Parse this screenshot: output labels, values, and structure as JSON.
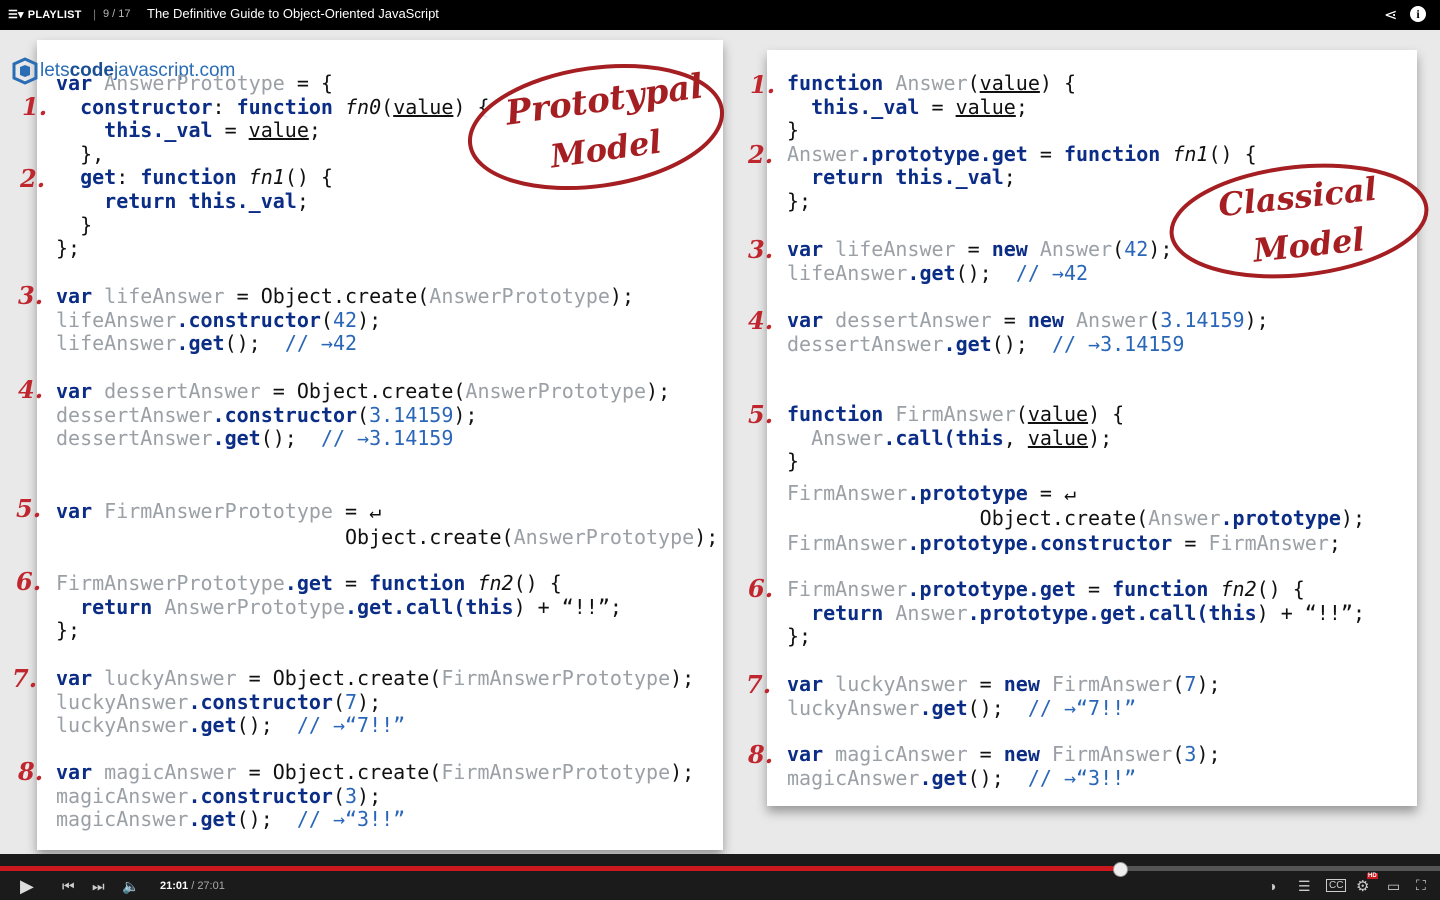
{
  "topbar": {
    "playlist_label": "PLAYLIST",
    "position": "9 / 17",
    "title": "The Definitive Guide to Object-Oriented JavaScript"
  },
  "logo": {
    "prefix": "lets",
    "bold": "code",
    "suffix": "javascript.com"
  },
  "stamps": {
    "prototypal": {
      "line1": "Prototypal",
      "line2": "Model"
    },
    "classical": {
      "line1": "Classical",
      "line2": "Model"
    }
  },
  "numbers": {
    "n1": "1.",
    "n2": "2.",
    "n3": "3.",
    "n4": "4.",
    "n5": "5.",
    "n6": "6.",
    "n7": "7.",
    "n8": "8."
  },
  "left_code": {
    "l1": "var ",
    "l1b": "AnswerPrototype",
    "l1c": " = {",
    "l2a": "  constructor",
    "l2b": ": ",
    "l2c": "function",
    "l2d": " fn0",
    "l2e": "(",
    "l2f": "value",
    "l2g": ") {",
    "l3a": "    this",
    "l3b": "._val",
    "l3c": " = ",
    "l3d": "value",
    "l3e": ";",
    "l4": "  },",
    "l5a": "  get",
    "l5b": ": ",
    "l5c": "function",
    "l5d": " fn1",
    "l5e": "() {",
    "l6a": "    return this",
    "l6b": "._val",
    "l6c": ";",
    "l7": "  }",
    "l8": "};",
    "b3a": "var ",
    "b3b": "lifeAnswer",
    "b3c": " = Object.create(",
    "b3d": "AnswerPrototype",
    "b3e": ");",
    "b3f": "lifeAnswer",
    "b3g": ".constructor",
    "b3h": "(",
    "b3i": "42",
    "b3j": ");",
    "b3k": "lifeAnswer",
    "b3l": ".get",
    "b3m": "();  ",
    "b3n": "// →42",
    "b4a": "var ",
    "b4b": "dessertAnswer",
    "b4c": " = Object.create(",
    "b4d": "AnswerPrototype",
    "b4e": ");",
    "b4f": "dessertAnswer",
    "b4g": ".constructor",
    "b4h": "(",
    "b4i": "3.14159",
    "b4j": ");",
    "b4k": "dessertAnswer",
    "b4l": ".get",
    "b4m": "();  ",
    "b4n": "// →3.14159",
    "b5a": "var ",
    "b5b": "FirmAnswerPrototype",
    "b5c": " = ↵",
    "b5d": "                        Object.create(",
    "b5e": "AnswerPrototype",
    "b5f": ");",
    "b6a": "FirmAnswerPrototype",
    "b6b": ".get",
    "b6c": " = ",
    "b6d": "function",
    "b6e": " fn2",
    "b6f": "() {",
    "b6g": "  return ",
    "b6h": "AnswerPrototype",
    "b6i": ".get.call(",
    "b6j": "this",
    "b6k": ") + “!!”;",
    "b6l": "};",
    "b7a": "var ",
    "b7b": "luckyAnswer",
    "b7c": " = Object.create(",
    "b7d": "FirmAnswerPrototype",
    "b7e": ");",
    "b7f": "luckyAnswer",
    "b7g": ".constructor",
    "b7h": "(",
    "b7i": "7",
    "b7j": ");",
    "b7k": "luckyAnswer",
    "b7l": ".get",
    "b7m": "();  ",
    "b7n": "// →“7!!”",
    "b8a": "var ",
    "b8b": "magicAnswer",
    "b8c": " = Object.create(",
    "b8d": "FirmAnswerPrototype",
    "b8e": ");",
    "b8f": "magicAnswer",
    "b8g": ".constructor",
    "b8h": "(",
    "b8i": "3",
    "b8j": ");",
    "b8k": "magicAnswer",
    "b8l": ".get",
    "b8m": "();  ",
    "b8n": "// →“3!!”"
  },
  "right_code": {
    "r1a": "function ",
    "r1b": "Answer",
    "r1c": "(",
    "r1d": "value",
    "r1e": ") {",
    "r1f": "  this",
    "r1g": "._val",
    "r1h": " = ",
    "r1i": "value",
    "r1j": ";",
    "r1k": "}",
    "r2a": "Answer",
    "r2b": ".prototype.get",
    "r2c": " = ",
    "r2d": "function",
    "r2e": " fn1",
    "r2f": "() {",
    "r2g": "  return this",
    "r2h": "._val",
    "r2i": ";",
    "r2j": "};",
    "r3a": "var ",
    "r3b": "lifeAnswer",
    "r3c": " = ",
    "r3d": "new ",
    "r3e": "Answer",
    "r3f": "(",
    "r3g": "42",
    "r3h": ");",
    "r3i": "lifeAnswer",
    "r3j": ".get",
    "r3k": "();  ",
    "r3l": "// →42",
    "r4a": "var ",
    "r4b": "dessertAnswer",
    "r4c": " = ",
    "r4d": "new ",
    "r4e": "Answer",
    "r4f": "(",
    "r4g": "3.14159",
    "r4h": ");",
    "r4i": "dessertAnswer",
    "r4j": ".get",
    "r4k": "();  ",
    "r4l": "// →3.14159",
    "r5a": "function ",
    "r5b": "FirmAnswer",
    "r5c": "(",
    "r5d": "value",
    "r5e": ") {",
    "r5f": "  Answer",
    "r5g": ".call(",
    "r5h": "this",
    "r5i": ", ",
    "r5j": "value",
    "r5k": ");",
    "r5l": "}",
    "r5m": "FirmAnswer",
    "r5n": ".prototype",
    "r5o": " = ↵",
    "r5p": "                Object.create(",
    "r5q": "Answer",
    "r5r": ".prototype",
    "r5s": ");",
    "r5t": "FirmAnswer",
    "r5u": ".prototype.constructor",
    "r5v": " = ",
    "r5w": "FirmAnswer",
    "r5x": ";",
    "r6a": "FirmAnswer",
    "r6b": ".prototype.get",
    "r6c": " = ",
    "r6d": "function",
    "r6e": " fn2",
    "r6f": "() {",
    "r6g": "  return ",
    "r6h": "Answer",
    "r6i": ".prototype.get.call(",
    "r6j": "this",
    "r6k": ") + “!!”;",
    "r6l": "};",
    "r7a": "var ",
    "r7b": "luckyAnswer",
    "r7c": " = ",
    "r7d": "new ",
    "r7e": "FirmAnswer",
    "r7f": "(",
    "r7g": "7",
    "r7h": ");",
    "r7i": "luckyAnswer",
    "r7j": ".get",
    "r7k": "();  ",
    "r7l": "// →“7!!”",
    "r8a": "var ",
    "r8b": "magicAnswer",
    "r8c": " = ",
    "r8d": "new ",
    "r8e": "FirmAnswer",
    "r8f": "(",
    "r8g": "3",
    "r8h": ");",
    "r8i": "magicAnswer",
    "r8j": ".get",
    "r8k": "();  ",
    "r8l": "// →“3!!”"
  },
  "player": {
    "current_time": "21:01",
    "duration": "27:01",
    "progress_fraction": 0.7778,
    "hd_badge": "HD",
    "accent_color": "#cc181e"
  }
}
